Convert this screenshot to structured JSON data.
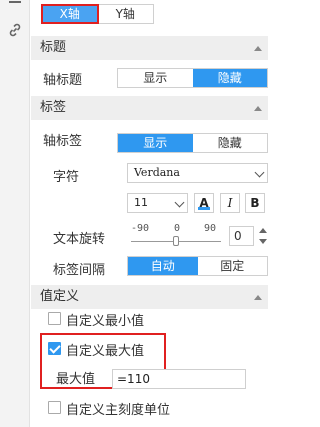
{
  "rail": {
    "icons": [
      "list-icon",
      "link-icon"
    ]
  },
  "axis_tabs": [
    {
      "label": "X轴",
      "active": true
    },
    {
      "label": "Y轴",
      "active": false
    }
  ],
  "sections": {
    "title": "标题",
    "label": "标签",
    "value": "值定义"
  },
  "axis_title": {
    "label": "轴标题",
    "show": "显示",
    "hide": "隐藏"
  },
  "axis_label": {
    "label": "轴标签",
    "show": "显示",
    "hide": "隐藏"
  },
  "font": {
    "label": "字符",
    "family": "Verdana",
    "size": "11",
    "color_btn": "A",
    "italic_btn": "I",
    "bold_btn": "B"
  },
  "rotate": {
    "label": "文本旋转",
    "min": "-90",
    "mid": "0",
    "max": "90",
    "value": "0"
  },
  "interval": {
    "label": "标签间隔",
    "auto": "自动",
    "fixed": "固定"
  },
  "custom": {
    "min_label": "自定义最小值",
    "max_label": "自定义最大值",
    "max_value_label": "最大值",
    "max_value": "=110",
    "major_unit_label": "自定义主刻度单位"
  },
  "colors": {
    "accent": "#2f98f0",
    "highlight": "#e02020",
    "header_bg": "#eeeeee"
  }
}
